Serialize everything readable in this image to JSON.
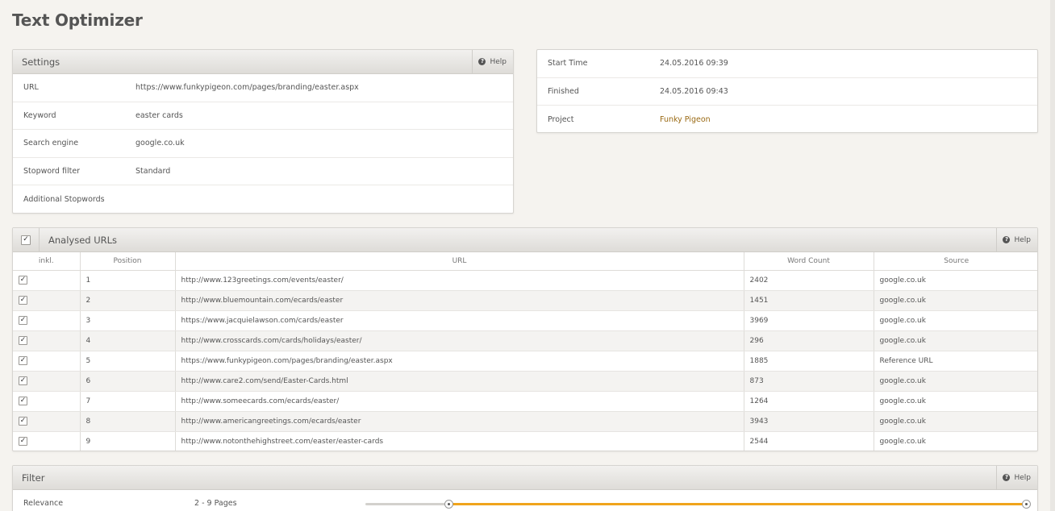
{
  "app": {
    "title": "Text Optimizer"
  },
  "settings": {
    "title": "Settings",
    "help_label": "Help",
    "rows": [
      {
        "key": "URL",
        "value": "https://www.funkypigeon.com/pages/branding/easter.aspx"
      },
      {
        "key": "Keyword",
        "value": "easter cards"
      },
      {
        "key": "Search engine",
        "value": "google.co.uk"
      },
      {
        "key": "Stopword filter",
        "value": "Standard"
      },
      {
        "key": "Additional Stopwords",
        "value": ""
      }
    ]
  },
  "info": {
    "rows": [
      {
        "key": "Start Time",
        "value": "24.05.2016 09:39"
      },
      {
        "key": "Finished",
        "value": "24.05.2016 09:43"
      },
      {
        "key": "Project",
        "value": "Funky Pigeon"
      }
    ]
  },
  "analysed": {
    "title": "Analysed URLs",
    "help_label": "Help",
    "columns": [
      "inkl.",
      "Position",
      "URL",
      "Word Count",
      "Source"
    ],
    "rows": [
      {
        "checked": true,
        "position": "1",
        "url": "http://www.123greetings.com/events/easter/",
        "word_count": "2402",
        "source": "google.co.uk"
      },
      {
        "checked": true,
        "position": "2",
        "url": "http://www.bluemountain.com/ecards/easter",
        "word_count": "1451",
        "source": "google.co.uk"
      },
      {
        "checked": true,
        "position": "3",
        "url": "https://www.jacquielawson.com/cards/easter",
        "word_count": "3969",
        "source": "google.co.uk"
      },
      {
        "checked": true,
        "position": "4",
        "url": "http://www.crosscards.com/cards/holidays/easter/",
        "word_count": "296",
        "source": "google.co.uk"
      },
      {
        "checked": true,
        "position": "5",
        "url": "https://www.funkypigeon.com/pages/branding/easter.aspx",
        "word_count": "1885",
        "source": "Reference URL"
      },
      {
        "checked": true,
        "position": "6",
        "url": "http://www.care2.com/send/Easter-Cards.html",
        "word_count": "873",
        "source": "google.co.uk"
      },
      {
        "checked": true,
        "position": "7",
        "url": "http://www.someecards.com/ecards/easter/",
        "word_count": "1264",
        "source": "google.co.uk"
      },
      {
        "checked": true,
        "position": "8",
        "url": "http://www.americangreetings.com/ecards/easter",
        "word_count": "3943",
        "source": "google.co.uk"
      },
      {
        "checked": true,
        "position": "9",
        "url": "http://www.notonthehighstreet.com/easter/easter-cards",
        "word_count": "2544",
        "source": "google.co.uk"
      }
    ]
  },
  "filter": {
    "title": "Filter",
    "help_label": "Help",
    "relevance_label": "Relevance",
    "relevance_value": "2 - 9 Pages",
    "slider_min": 1,
    "slider_max": 9,
    "range_low": 2,
    "range_high": 9
  },
  "colors": {
    "accent": "#f0a41c",
    "link": "#9a6a14",
    "background": "#f5f3ef"
  },
  "icons": {
    "help": "help-circle-icon",
    "check": "check-icon"
  }
}
